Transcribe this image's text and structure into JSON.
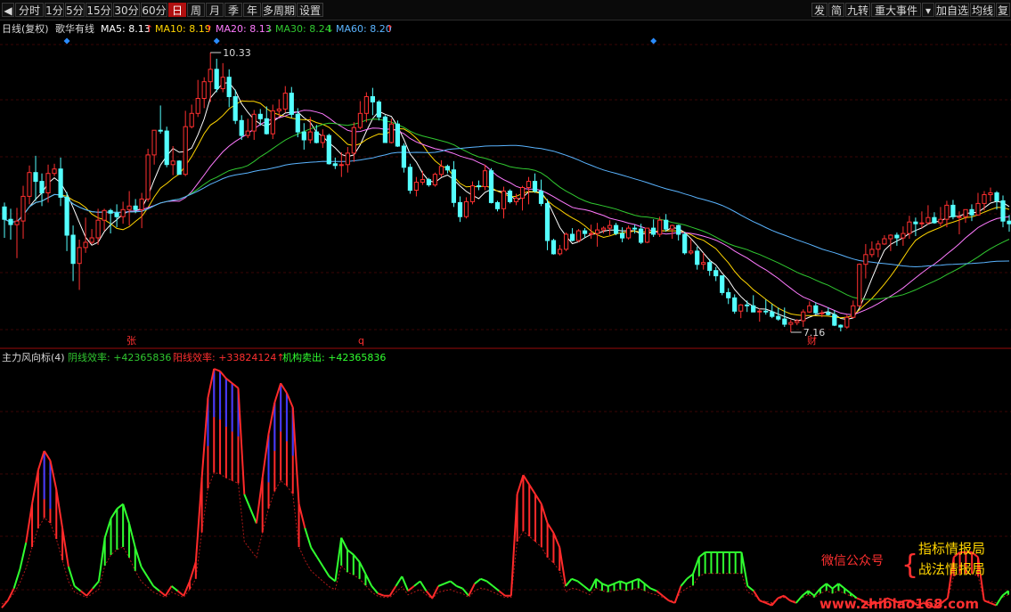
{
  "toolbar": {
    "left": [
      "◀",
      "分时",
      "1分",
      "5分",
      "15分",
      "30分",
      "60分",
      "日",
      "周",
      "月",
      "季",
      "年",
      "多周期",
      "设置"
    ],
    "active": "日",
    "right": [
      "发",
      "简",
      "九转",
      "重大事件",
      "▾",
      "加自选",
      "均线",
      "复"
    ]
  },
  "ma_legend": {
    "period": "日线(复权)",
    "indicator": "歌华有线",
    "ma5": "MA5: 8.13",
    "ma5_arrow": "↑",
    "ma10": "MA10: 8.19",
    "ma10_arrow": "↑",
    "ma20": "MA20: 8.13",
    "ma20_arrow": "↓",
    "ma30": "MA30: 8.24",
    "ma30_arrow": "↓",
    "ma60": "MA60: 8.20",
    "ma60_arrow": "↑"
  },
  "price_labels": {
    "high": "10.33",
    "low": "7.16"
  },
  "event_marks": [
    "张",
    "q",
    "财"
  ],
  "indicator_legend": {
    "name": "主力风向标(4)",
    "bear": "阴线效率: +42365836",
    "bull": "阳线效率: +33824124↑",
    "inst": "机构卖出: +42365836"
  },
  "watermark": {
    "wechat": "微信公众号",
    "brace": "{",
    "line1": "指标情报局",
    "line2": "战法情报局",
    "url": "www.zhibiao168.com"
  },
  "colors": {
    "up": "#ff3030",
    "down": "#54ffff",
    "ma5": "#ffffff",
    "ma10": "#ffd500",
    "ma20": "#ff7aff",
    "ma30": "#30c830",
    "ma60": "#5ab4ff",
    "bar_red": "#ff2a2a",
    "bar_green": "#30ff30",
    "bar_blue": "#3a3aff"
  },
  "chart_data": {
    "type": "candlestick",
    "price_range": [
      7.16,
      10.33
    ],
    "candles": [
      [
        8.57,
        8.62,
        8.22,
        8.43
      ],
      [
        8.43,
        8.55,
        8.2,
        8.37
      ],
      [
        8.37,
        8.56,
        7.99,
        8.41
      ],
      [
        8.41,
        8.81,
        8.21,
        8.69
      ],
      [
        8.69,
        9.04,
        8.6,
        8.96
      ],
      [
        8.96,
        9.15,
        8.64,
        8.86
      ],
      [
        8.86,
        8.95,
        8.58,
        8.73
      ],
      [
        8.73,
        9.05,
        8.62,
        8.95
      ],
      [
        8.95,
        9.06,
        8.92,
        9.0
      ],
      [
        9.0,
        9.13,
        8.58,
        8.68
      ],
      [
        8.68,
        8.74,
        8.07,
        8.25
      ],
      [
        8.25,
        8.36,
        7.73,
        7.93
      ],
      [
        7.93,
        8.2,
        7.63,
        8.11
      ],
      [
        8.11,
        8.45,
        8.05,
        8.17
      ],
      [
        8.17,
        8.32,
        8.15,
        8.22
      ],
      [
        8.22,
        8.55,
        8.14,
        8.42
      ],
      [
        8.42,
        8.55,
        8.3,
        8.53
      ],
      [
        8.53,
        8.55,
        8.27,
        8.5
      ],
      [
        8.5,
        8.6,
        8.34,
        8.46
      ],
      [
        8.46,
        8.63,
        8.38,
        8.54
      ],
      [
        8.54,
        8.75,
        8.36,
        8.58
      ],
      [
        8.58,
        8.66,
        8.5,
        8.54
      ],
      [
        8.54,
        8.73,
        8.33,
        8.66
      ],
      [
        8.66,
        9.23,
        8.63,
        9.16
      ],
      [
        9.16,
        9.44,
        9.05,
        9.44
      ],
      [
        9.44,
        9.72,
        9.4,
        9.43
      ],
      [
        9.43,
        9.48,
        9.02,
        9.05
      ],
      [
        9.05,
        9.26,
        8.93,
        9.09
      ],
      [
        9.09,
        9.1,
        8.94,
        8.94
      ],
      [
        8.94,
        9.66,
        8.92,
        9.48
      ],
      [
        9.48,
        9.73,
        9.46,
        9.63
      ],
      [
        9.63,
        10.01,
        9.59,
        9.8
      ],
      [
        9.8,
        10.04,
        9.69,
        9.99
      ],
      [
        9.99,
        10.32,
        9.76,
        10.13
      ],
      [
        10.13,
        10.25,
        9.87,
        9.91
      ],
      [
        9.91,
        10.2,
        9.87,
        10.04
      ],
      [
        10.04,
        10.13,
        9.7,
        9.82
      ],
      [
        9.82,
        9.9,
        9.51,
        9.55
      ],
      [
        9.55,
        9.61,
        9.33,
        9.38
      ],
      [
        9.38,
        9.57,
        9.35,
        9.43
      ],
      [
        9.43,
        9.67,
        9.33,
        9.62
      ],
      [
        9.62,
        9.68,
        9.49,
        9.57
      ],
      [
        9.57,
        9.71,
        9.39,
        9.4
      ],
      [
        9.4,
        9.73,
        9.34,
        9.66
      ],
      [
        9.66,
        9.79,
        9.59,
        9.68
      ],
      [
        9.68,
        9.94,
        9.64,
        9.86
      ],
      [
        9.86,
        9.93,
        9.58,
        9.62
      ],
      [
        9.62,
        9.69,
        9.36,
        9.42
      ],
      [
        9.42,
        9.52,
        9.22,
        9.33
      ],
      [
        9.33,
        9.59,
        9.29,
        9.42
      ],
      [
        9.42,
        9.5,
        9.29,
        9.3
      ],
      [
        9.3,
        9.45,
        9.24,
        9.38
      ],
      [
        9.38,
        9.4,
        9.05,
        9.06
      ],
      [
        9.06,
        9.13,
        9.0,
        9.04
      ],
      [
        9.04,
        9.19,
        8.91,
        9.05
      ],
      [
        9.05,
        9.25,
        8.96,
        9.18
      ],
      [
        9.18,
        9.53,
        9.08,
        9.47
      ],
      [
        9.47,
        9.77,
        9.45,
        9.63
      ],
      [
        9.63,
        9.87,
        9.53,
        9.82
      ],
      [
        9.82,
        9.92,
        9.61,
        9.76
      ],
      [
        9.76,
        9.78,
        9.55,
        9.59
      ],
      [
        9.59,
        9.61,
        9.3,
        9.3
      ],
      [
        9.3,
        9.57,
        9.29,
        9.51
      ],
      [
        9.51,
        9.55,
        9.25,
        9.26
      ],
      [
        9.26,
        9.29,
        8.96,
        9.02
      ],
      [
        9.02,
        9.06,
        8.72,
        8.76
      ],
      [
        8.76,
        8.91,
        8.69,
        8.85
      ],
      [
        8.85,
        8.98,
        8.82,
        8.88
      ],
      [
        8.88,
        8.9,
        8.8,
        8.82
      ],
      [
        8.82,
        8.96,
        8.8,
        8.94
      ],
      [
        8.94,
        9.1,
        8.91,
        9.03
      ],
      [
        9.03,
        9.05,
        8.95,
        8.99
      ],
      [
        8.99,
        9.09,
        8.57,
        8.62
      ],
      [
        8.62,
        8.69,
        8.4,
        8.46
      ],
      [
        8.46,
        8.68,
        8.44,
        8.63
      ],
      [
        8.63,
        8.86,
        8.6,
        8.81
      ],
      [
        8.81,
        8.87,
        8.76,
        8.8
      ],
      [
        8.8,
        9.05,
        8.76,
        8.98
      ],
      [
        8.98,
        9.01,
        8.61,
        8.62
      ],
      [
        8.62,
        8.64,
        8.52,
        8.55
      ],
      [
        8.55,
        8.8,
        8.44,
        8.75
      ],
      [
        8.75,
        8.77,
        8.61,
        8.63
      ],
      [
        8.63,
        8.72,
        8.59,
        8.67
      ],
      [
        8.67,
        8.81,
        8.53,
        8.79
      ],
      [
        8.79,
        8.91,
        8.6,
        8.86
      ],
      [
        8.86,
        8.95,
        8.73,
        8.75
      ],
      [
        8.75,
        8.88,
        8.58,
        8.61
      ],
      [
        8.61,
        8.66,
        8.08,
        8.19
      ],
      [
        8.19,
        8.21,
        8.03,
        8.04
      ],
      [
        8.04,
        8.14,
        8.02,
        8.09
      ],
      [
        8.09,
        8.28,
        8.07,
        8.26
      ],
      [
        8.26,
        8.33,
        8.18,
        8.19
      ],
      [
        8.19,
        8.32,
        8.17,
        8.3
      ],
      [
        8.3,
        8.33,
        8.22,
        8.27
      ],
      [
        8.27,
        8.37,
        8.21,
        8.27
      ],
      [
        8.27,
        8.39,
        8.12,
        8.31
      ],
      [
        8.31,
        8.35,
        8.27,
        8.33
      ],
      [
        8.33,
        8.42,
        8.25,
        8.36
      ],
      [
        8.36,
        8.39,
        8.25,
        8.27
      ],
      [
        8.27,
        8.34,
        8.17,
        8.22
      ],
      [
        8.22,
        8.36,
        8.2,
        8.33
      ],
      [
        8.33,
        8.37,
        8.27,
        8.32
      ],
      [
        8.32,
        8.38,
        8.15,
        8.17
      ],
      [
        8.17,
        8.33,
        8.16,
        8.33
      ],
      [
        8.33,
        8.43,
        8.23,
        8.26
      ],
      [
        8.26,
        8.46,
        8.23,
        8.42
      ],
      [
        8.42,
        8.49,
        8.29,
        8.32
      ],
      [
        8.32,
        8.37,
        8.21,
        8.36
      ],
      [
        8.36,
        8.37,
        8.19,
        8.26
      ],
      [
        8.26,
        8.29,
        8.03,
        8.05
      ],
      [
        8.05,
        8.21,
        8.03,
        8.07
      ],
      [
        8.07,
        8.12,
        7.86,
        7.92
      ],
      [
        7.92,
        8.05,
        7.86,
        7.94
      ],
      [
        7.94,
        7.98,
        7.79,
        7.85
      ],
      [
        7.85,
        7.89,
        7.73,
        7.79
      ],
      [
        7.79,
        7.79,
        7.57,
        7.6
      ],
      [
        7.6,
        7.65,
        7.47,
        7.54
      ],
      [
        7.54,
        7.58,
        7.36,
        7.39
      ],
      [
        7.39,
        7.47,
        7.31,
        7.46
      ],
      [
        7.46,
        7.51,
        7.38,
        7.45
      ],
      [
        7.45,
        7.57,
        7.38,
        7.38
      ],
      [
        7.38,
        7.42,
        7.27,
        7.39
      ],
      [
        7.39,
        7.52,
        7.35,
        7.38
      ],
      [
        7.38,
        7.47,
        7.31,
        7.33
      ],
      [
        7.33,
        7.43,
        7.28,
        7.3
      ],
      [
        7.3,
        7.43,
        7.21,
        7.24
      ],
      [
        7.24,
        7.29,
        7.15,
        7.26
      ],
      [
        7.26,
        7.3,
        7.23,
        7.28
      ],
      [
        7.28,
        7.41,
        7.21,
        7.38
      ],
      [
        7.38,
        7.5,
        7.37,
        7.45
      ],
      [
        7.45,
        7.49,
        7.35,
        7.37
      ],
      [
        7.37,
        7.4,
        7.32,
        7.37
      ],
      [
        7.37,
        7.43,
        7.34,
        7.35
      ],
      [
        7.35,
        7.4,
        7.22,
        7.23
      ],
      [
        7.23,
        7.24,
        7.16,
        7.21
      ],
      [
        7.21,
        7.35,
        7.19,
        7.32
      ],
      [
        7.32,
        7.51,
        7.31,
        7.45
      ],
      [
        7.45,
        7.93,
        7.44,
        7.92
      ],
      [
        7.92,
        8.15,
        7.76,
        8.03
      ],
      [
        8.03,
        8.18,
        8.0,
        8.09
      ],
      [
        8.09,
        8.19,
        8.0,
        8.15
      ],
      [
        8.15,
        8.25,
        8.14,
        8.21
      ],
      [
        8.21,
        8.26,
        8.07,
        8.25
      ],
      [
        8.25,
        8.28,
        8.13,
        8.22
      ],
      [
        8.22,
        8.35,
        8.13,
        8.27
      ],
      [
        8.27,
        8.47,
        8.21,
        8.4
      ],
      [
        8.4,
        8.45,
        8.24,
        8.38
      ],
      [
        8.38,
        8.52,
        8.33,
        8.39
      ],
      [
        8.39,
        8.59,
        8.37,
        8.45
      ],
      [
        8.45,
        8.51,
        8.38,
        8.39
      ],
      [
        8.39,
        8.57,
        8.35,
        8.43
      ],
      [
        8.43,
        8.64,
        8.34,
        8.59
      ],
      [
        8.59,
        8.65,
        8.43,
        8.46
      ],
      [
        8.46,
        8.52,
        8.26,
        8.46
      ],
      [
        8.46,
        8.54,
        8.39,
        8.54
      ],
      [
        8.54,
        8.6,
        8.41,
        8.48
      ],
      [
        8.48,
        8.73,
        8.47,
        8.61
      ],
      [
        8.61,
        8.75,
        8.53,
        8.71
      ],
      [
        8.71,
        8.79,
        8.63,
        8.73
      ],
      [
        8.73,
        8.75,
        8.54,
        8.64
      ],
      [
        8.64,
        8.7,
        8.34,
        8.41
      ],
      [
        8.41,
        8.48,
        8.29,
        8.38
      ]
    ],
    "ma_periods": [
      5,
      10,
      20,
      30,
      60
    ],
    "indicator_range": [
      0,
      100
    ],
    "bars": [
      [
        1,
        "n"
      ],
      [
        4,
        "n"
      ],
      [
        9,
        "n"
      ],
      [
        17,
        "n"
      ],
      [
        28,
        "n"
      ],
      [
        44,
        "r"
      ],
      [
        58,
        "r"
      ],
      [
        66,
        "r"
      ],
      [
        62,
        "r"
      ],
      [
        50,
        "r"
      ],
      [
        34,
        "r"
      ],
      [
        18,
        "n"
      ],
      [
        10,
        "n"
      ],
      [
        8,
        "n"
      ],
      [
        6,
        "n"
      ],
      [
        9,
        "n"
      ],
      [
        12,
        "n"
      ],
      [
        30,
        "g"
      ],
      [
        38,
        "g"
      ],
      [
        42,
        "g"
      ],
      [
        44,
        "g"
      ],
      [
        36,
        "g"
      ],
      [
        26,
        "g"
      ],
      [
        18,
        "n"
      ],
      [
        14,
        "n"
      ],
      [
        10,
        "n"
      ],
      [
        8,
        "n"
      ],
      [
        6,
        "n"
      ],
      [
        10,
        "n"
      ],
      [
        8,
        "n"
      ],
      [
        6,
        "n"
      ],
      [
        12,
        "r"
      ],
      [
        20,
        "r"
      ],
      [
        55,
        "r"
      ],
      [
        88,
        "r"
      ],
      [
        100,
        "r"
      ],
      [
        99,
        "r"
      ],
      [
        96,
        "r"
      ],
      [
        94,
        "r"
      ],
      [
        92,
        "r"
      ],
      [
        48,
        "n"
      ],
      [
        42,
        "n"
      ],
      [
        36,
        "n"
      ],
      [
        55,
        "r"
      ],
      [
        73,
        "r"
      ],
      [
        86,
        "r"
      ],
      [
        94,
        "r"
      ],
      [
        90,
        "r"
      ],
      [
        84,
        "r"
      ],
      [
        44,
        "r"
      ],
      [
        34,
        "n"
      ],
      [
        26,
        "n"
      ],
      [
        22,
        "n"
      ],
      [
        18,
        "n"
      ],
      [
        14,
        "n"
      ],
      [
        12,
        "n"
      ],
      [
        30,
        "g"
      ],
      [
        25,
        "g"
      ],
      [
        23,
        "g"
      ],
      [
        20,
        "g"
      ],
      [
        15,
        "g"
      ],
      [
        10,
        "n"
      ],
      [
        7,
        "n"
      ],
      [
        6,
        "n"
      ],
      [
        6,
        "n"
      ],
      [
        10,
        "n"
      ],
      [
        14,
        "n"
      ],
      [
        8,
        "n"
      ],
      [
        10,
        "n"
      ],
      [
        12,
        "n"
      ],
      [
        8,
        "n"
      ],
      [
        5,
        "n"
      ],
      [
        10,
        "n"
      ],
      [
        11,
        "n"
      ],
      [
        12,
        "n"
      ],
      [
        10,
        "n"
      ],
      [
        9,
        "n"
      ],
      [
        6,
        "n"
      ],
      [
        11,
        "n"
      ],
      [
        13,
        "n"
      ],
      [
        12,
        "n"
      ],
      [
        10,
        "n"
      ],
      [
        8,
        "n"
      ],
      [
        6,
        "n"
      ],
      [
        6,
        "n"
      ],
      [
        48,
        "r"
      ],
      [
        56,
        "r"
      ],
      [
        52,
        "r"
      ],
      [
        48,
        "r"
      ],
      [
        44,
        "r"
      ],
      [
        36,
        "r"
      ],
      [
        32,
        "r"
      ],
      [
        26,
        "r"
      ],
      [
        10,
        "n"
      ],
      [
        13,
        "n"
      ],
      [
        12,
        "n"
      ],
      [
        10,
        "n"
      ],
      [
        8,
        "n"
      ],
      [
        13,
        "g"
      ],
      [
        11,
        "g"
      ],
      [
        10,
        "g"
      ],
      [
        11,
        "g"
      ],
      [
        12,
        "g"
      ],
      [
        11,
        "g"
      ],
      [
        12,
        "g"
      ],
      [
        13,
        "g"
      ],
      [
        11,
        "g"
      ],
      [
        9,
        "n"
      ],
      [
        8,
        "n"
      ],
      [
        6,
        "n"
      ],
      [
        4,
        "n"
      ],
      [
        3,
        "n"
      ],
      [
        10,
        "n"
      ],
      [
        13,
        "n"
      ],
      [
        15,
        "g"
      ],
      [
        22,
        "g"
      ],
      [
        24,
        "g"
      ],
      [
        24,
        "g"
      ],
      [
        24,
        "g"
      ],
      [
        24,
        "g"
      ],
      [
        24,
        "g"
      ],
      [
        24,
        "g"
      ],
      [
        24,
        "g"
      ],
      [
        10,
        "n"
      ],
      [
        8,
        "n"
      ],
      [
        4,
        "n"
      ],
      [
        3,
        "r"
      ],
      [
        2,
        "r"
      ],
      [
        5,
        "r"
      ],
      [
        6,
        "r"
      ],
      [
        4,
        "r"
      ],
      [
        3,
        "n"
      ],
      [
        6,
        "g"
      ],
      [
        8,
        "g"
      ],
      [
        6,
        "g"
      ],
      [
        9,
        "g"
      ],
      [
        11,
        "g"
      ],
      [
        9,
        "g"
      ],
      [
        11,
        "g"
      ],
      [
        9,
        "g"
      ],
      [
        7,
        "g"
      ],
      [
        5,
        "n"
      ],
      [
        4,
        "n"
      ],
      [
        2,
        "n"
      ],
      [
        3,
        "n"
      ],
      [
        3,
        "n"
      ],
      [
        5,
        "n"
      ],
      [
        4,
        "n"
      ],
      [
        3,
        "n"
      ],
      [
        4,
        "n"
      ],
      [
        4,
        "n"
      ],
      [
        2,
        "n"
      ],
      [
        3,
        "n"
      ],
      [
        2,
        "n"
      ],
      [
        1,
        "n"
      ],
      [
        3,
        "n"
      ],
      [
        5,
        "n"
      ],
      [
        22,
        "r"
      ],
      [
        24,
        "r"
      ],
      [
        24,
        "r"
      ],
      [
        24,
        "r"
      ],
      [
        22,
        "r"
      ],
      [
        4,
        "n"
      ],
      [
        3,
        "n"
      ],
      [
        2,
        "n"
      ],
      [
        6,
        "g"
      ],
      [
        8,
        "g"
      ]
    ]
  }
}
